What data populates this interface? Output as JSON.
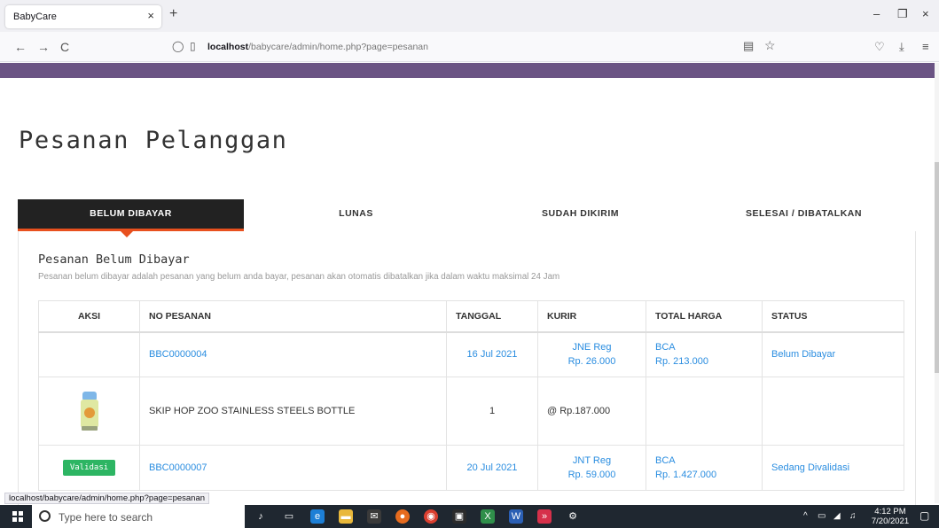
{
  "browser": {
    "tab_title": "BabyCare",
    "tab_close": "×",
    "new_tab": "+",
    "url_host": "localhost",
    "url_path": "/babycare/admin/home.php?page=pesanan",
    "status_url": "localhost/babycare/admin/home.php?page=pesanan",
    "buttons": {
      "back": "←",
      "forward": "→",
      "reload": "C",
      "minimize": "–",
      "restore": "❐",
      "close": "×"
    }
  },
  "page": {
    "title": "Pesanan Pelanggan",
    "tabs": [
      {
        "label": "BELUM DIBAYAR",
        "active": true
      },
      {
        "label": "LUNAS"
      },
      {
        "label": "SUDAH DIKIRIM"
      },
      {
        "label": "SELESAI / DIBATALKAN"
      }
    ],
    "section_title": "Pesanan Belum Dibayar",
    "section_desc": "Pesanan belum dibayar adalah pesanan yang belum anda bayar, pesanan akan otomatis dibatalkan jika dalam waktu maksimal 24 Jam",
    "table": {
      "headers": [
        "AKSI",
        "NO PESANAN",
        "TANGGAL",
        "KURIR",
        "TOTAL HARGA",
        "STATUS"
      ],
      "orders": [
        {
          "action": "",
          "no": "BBC0000004",
          "date": "16 Jul 2021",
          "courier": "JNE Reg",
          "courier_cost": "Rp. 26.000",
          "bank": "BCA",
          "total": "Rp. 213.000",
          "status": "Belum Dibayar"
        },
        {
          "item": true,
          "product": "SKIP HOP ZOO STAINLESS STEELS BOTTLE",
          "qty": "1",
          "price": "@ Rp.187.000"
        },
        {
          "action": "Validasi",
          "no": "BBC0000007",
          "date": "20 Jul 2021",
          "courier": "JNT Reg",
          "courier_cost": "Rp. 59.000",
          "bank": "BCA",
          "total": "Rp. 1.427.000",
          "status": "Sedang Divalidasi"
        }
      ]
    }
  },
  "taskbar": {
    "search_placeholder": "Type here to search",
    "time": "4:12 PM",
    "date": "7/20/2021"
  },
  "colors": {
    "accent_purple": "#6b5484",
    "tab_active_bg": "#222222",
    "tab_active_border": "#e8501e",
    "link_blue": "#2a8de0",
    "validate_green": "#2db563"
  }
}
